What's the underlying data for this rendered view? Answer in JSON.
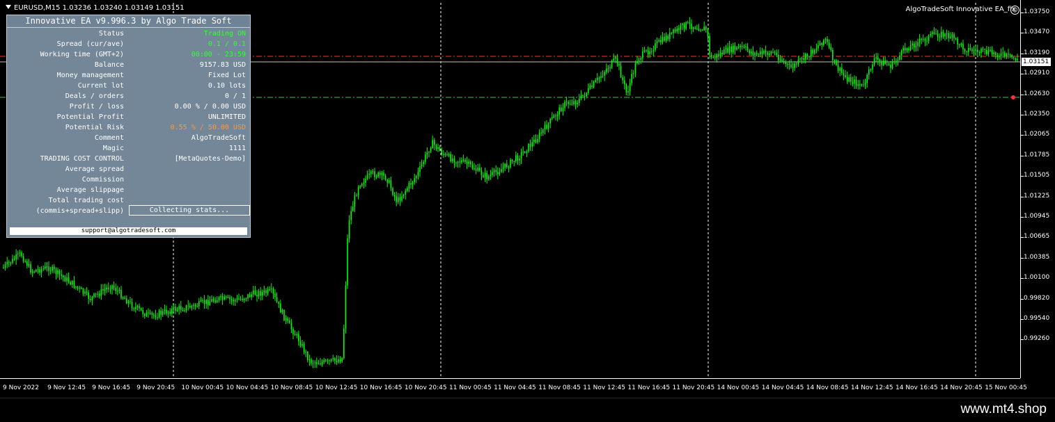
{
  "chart": {
    "title": "EURUSD,M15  1.03236 1.03240 1.03149 1.03151",
    "ea_label": "AlgoTradeSoft Innovative EA_fix",
    "smile_icon": "smiley-icon",
    "current_price": "1.03151",
    "colors": {
      "candle": "#00ff00",
      "bg": "#000000",
      "grid": "#ffffff",
      "red_line": "#ff3030",
      "green_line": "#33cc33"
    },
    "price_ticks": [
      "1.03750",
      "1.03470",
      "1.03190",
      "1.02910",
      "1.02630",
      "1.02350",
      "1.02065",
      "1.01785",
      "1.01505",
      "1.01225",
      "1.00945",
      "1.00665",
      "1.00385",
      "1.00100",
      "0.99820",
      "0.99540",
      "0.99260"
    ],
    "time_ticks": [
      "9 Nov 2022",
      "9 Nov 12:45",
      "9 Nov 16:45",
      "9 Nov 20:45",
      "10 Nov 00:45",
      "10 Nov 04:45",
      "10 Nov 08:45",
      "10 Nov 12:45",
      "10 Nov 16:45",
      "10 Nov 20:45",
      "11 Nov 00:45",
      "11 Nov 04:45",
      "11 Nov 08:45",
      "11 Nov 12:45",
      "11 Nov 16:45",
      "11 Nov 20:45",
      "14 Nov 00:45",
      "14 Nov 04:45",
      "14 Nov 08:45",
      "14 Nov 12:45",
      "14 Nov 16:45",
      "14 Nov 20:45",
      "15 Nov 00:45"
    ]
  },
  "panel": {
    "title": "Innovative EA v9.996.3 by Algo Trade Soft",
    "rows": [
      {
        "label": "Status",
        "value": "Trading ON",
        "color": "green"
      },
      {
        "label": "Spread (cur/ave)",
        "value": "0.1 / 0.1",
        "color": "green"
      },
      {
        "label": "Working time (GMT+2)",
        "value": "00:00 - 23:59",
        "color": "green"
      },
      {
        "label": "Balance",
        "value": "9157.83 USD",
        "color": "white"
      },
      {
        "label": "Money management",
        "value": "Fixed Lot",
        "color": "white"
      },
      {
        "label": "Current lot",
        "value": "0.10 lots",
        "color": "white"
      },
      {
        "label": "Deals / orders",
        "value": "0 / 1",
        "color": "white"
      },
      {
        "label": "Profit / loss",
        "value": "0.00 % / 0.00 USD",
        "color": "white"
      },
      {
        "label": "Potential Profit",
        "value": "UNLIMITED",
        "color": "white"
      },
      {
        "label": "Potential Risk",
        "value": "0.55 % / 50.00 USD",
        "color": "orange"
      },
      {
        "label": "Comment",
        "value": "AlgoTradeSoft",
        "color": "white"
      },
      {
        "label": "Magic",
        "value": "1111",
        "color": "white"
      },
      {
        "label": "TRADING COST CONTROL",
        "value": "[MetaQuotes-Demo]",
        "color": "white"
      },
      {
        "label": "Average spread",
        "value": "",
        "color": "white"
      },
      {
        "label": "Commission",
        "value": "",
        "color": "white"
      },
      {
        "label": "Average slippage",
        "value": "",
        "color": "white"
      },
      {
        "label": "Total trading cost",
        "value": "",
        "color": "white"
      },
      {
        "label": "(commis+spread+slipp)",
        "value": "",
        "color": "white"
      }
    ],
    "stats_button": "Collecting stats...",
    "support": "support@algotradesoft.com"
  },
  "footer": {
    "watermark": "www.mt4.shop"
  }
}
